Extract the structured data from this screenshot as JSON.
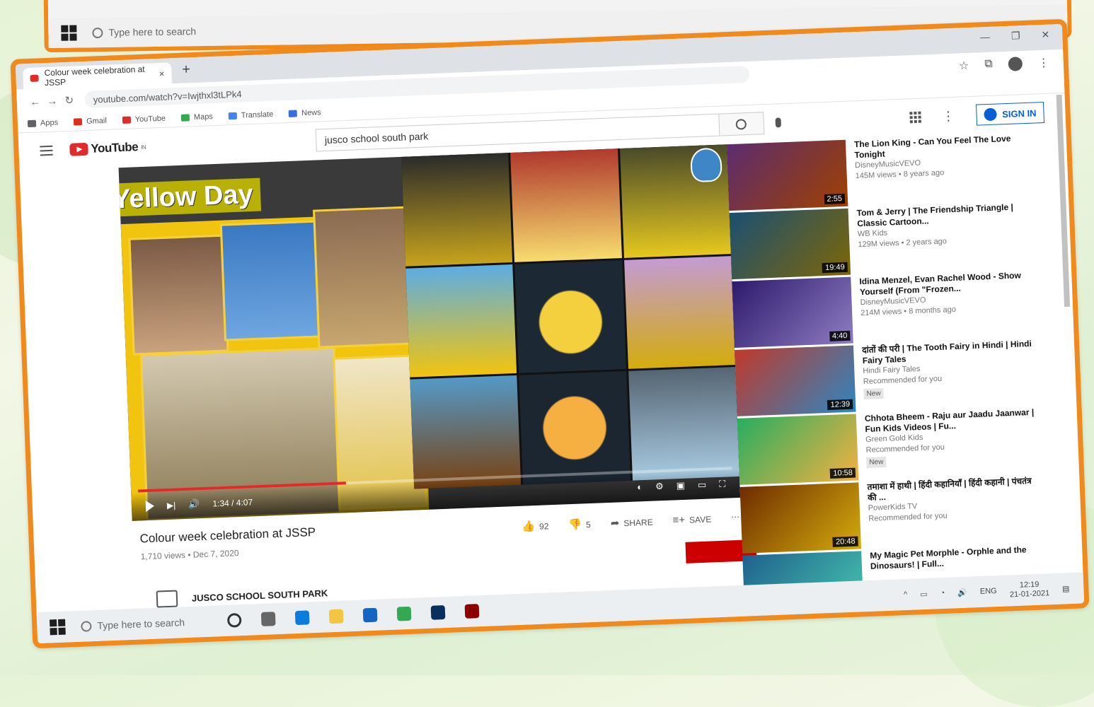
{
  "top_strip": {
    "search_placeholder": "Type here to search"
  },
  "browser": {
    "tab_title": "Colour week celebration at JSSP",
    "tab_close": "×",
    "new_tab": "+",
    "address": "youtube.com/watch?v=Iwjthxl3tLPk4",
    "window_controls": [
      "—",
      "❐",
      "✕"
    ],
    "nav": {
      "back": "←",
      "forward": "→",
      "reload": "↻"
    },
    "bookmarks": [
      {
        "label": "Apps",
        "color": "#5f6368"
      },
      {
        "label": "Gmail",
        "color": "#d93025"
      },
      {
        "label": "YouTube",
        "color": "#e02b2b"
      },
      {
        "label": "Maps",
        "color": "#34a853"
      },
      {
        "label": "Translate",
        "color": "#4285f4"
      },
      {
        "label": "News",
        "color": "#3b6fd6"
      }
    ]
  },
  "youtube": {
    "logo_text": "YouTube",
    "logo_superscript": "IN",
    "search_query": "jusco school south park",
    "sign_in": "SIGN IN",
    "video": {
      "overlay_title": "Yellow Day",
      "time": "1:34 / 4:07",
      "progress_fraction": 0.35,
      "title": "Colour week celebration at JSSP",
      "meta": "1,710 views • Dec 7, 2020",
      "likes": "92",
      "dislikes": "5",
      "share": "SHARE",
      "save": "SAVE",
      "more": "⋯",
      "channel": "JUSCO SCHOOL SOUTH PARK"
    },
    "recommendations": [
      {
        "title": "The Lion King - Can You Feel The Love Tonight",
        "channel": "DisneyMusicVEVO",
        "stats": "145M views • 8 years ago",
        "duration": "2:55",
        "colors": [
          "#5b2c6f",
          "#a04000"
        ]
      },
      {
        "title": "Tom & Jerry | The Friendship Triangle | Classic Cartoon...",
        "channel": "WB Kids",
        "stats": "129M views • 2 years ago",
        "duration": "19:49",
        "colors": [
          "#1b4f72",
          "#7d6608"
        ]
      },
      {
        "title": "Idina Menzel, Evan Rachel Wood - Show Yourself (From \"Frozen...",
        "channel": "DisneyMusicVEVO",
        "stats": "214M views • 8 months ago",
        "duration": "4:40",
        "colors": [
          "#2e1a6b",
          "#8e7cc3"
        ]
      },
      {
        "title": "दांतों की परी | The Tooth Fairy in Hindi | Hindi Fairy Tales",
        "channel": "Hindi Fairy Tales",
        "stats": "Recommended for you",
        "duration": "12:39",
        "new": "New",
        "colors": [
          "#c0392b",
          "#2e86c1"
        ]
      },
      {
        "title": "Chhota Bheem - Raju aur Jaadu Jaanwar | Fun Kids Videos | Fu...",
        "channel": "Green Gold Kids",
        "stats": "Recommended for you",
        "duration": "10:58",
        "new": "New",
        "colors": [
          "#27ae60",
          "#f5b041"
        ]
      },
      {
        "title": "तमाशा में हाथी | हिंदी कहानियाँ | हिंदी कहानी | पंचतंत्र की ...",
        "channel": "PowerKids TV",
        "stats": "Recommended for you",
        "duration": "20:48",
        "colors": [
          "#6e2c00",
          "#d4ac0d"
        ]
      },
      {
        "title": "My Magic Pet Morphle - Orphle and the Dinosaurs! | Full...",
        "channel": "",
        "stats": "",
        "duration": "",
        "colors": [
          "#1f618d",
          "#48c9b0"
        ]
      }
    ]
  },
  "taskbar": {
    "search_placeholder": "Type here to search",
    "lang": "ENG",
    "time": "12:19",
    "date": "21-01-2021",
    "apps": [
      {
        "name": "cortana",
        "color": "#333333"
      },
      {
        "name": "taskview",
        "color": "#666666"
      },
      {
        "name": "edge",
        "color": "#0c7bdc"
      },
      {
        "name": "explorer",
        "color": "#f4c542"
      },
      {
        "name": "store",
        "color": "#1565c0"
      },
      {
        "name": "chrome",
        "color": "#34a853"
      },
      {
        "name": "photoshop",
        "color": "#0b2f5c"
      },
      {
        "name": "acrobat",
        "color": "#8b0000"
      }
    ]
  }
}
